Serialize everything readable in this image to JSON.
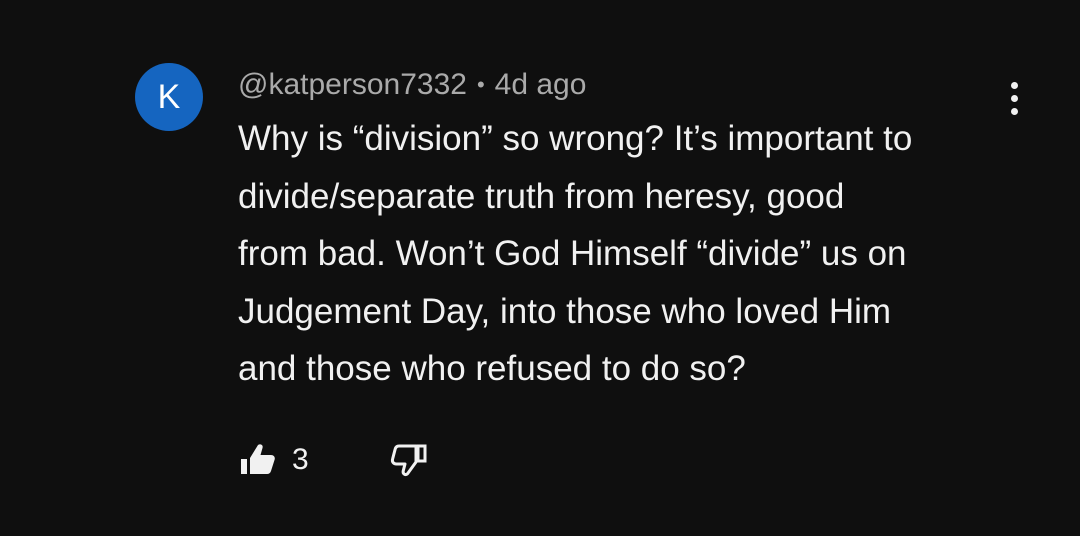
{
  "comment": {
    "avatar_letter": "K",
    "avatar_color": "#1565c0",
    "author": "@katperson7332",
    "separator": "•",
    "time_ago": "4d ago",
    "text_lines": [
      "Why is “division” so wrong? It’s important to",
      "divide/separate truth from heresy, good",
      "from bad. Won’t God Himself “divide” us on",
      "Judgement Day, into those who loved Him",
      "and those who refused to do so?"
    ],
    "like_count": "3",
    "icons": {
      "like": "thumbs-up-icon",
      "dislike": "thumbs-down-icon",
      "more": "more-vertical-icon"
    }
  },
  "theme": {
    "background": "#0f0f0f",
    "text": "#f1f1f1",
    "secondary_text": "#aaaaaa"
  }
}
